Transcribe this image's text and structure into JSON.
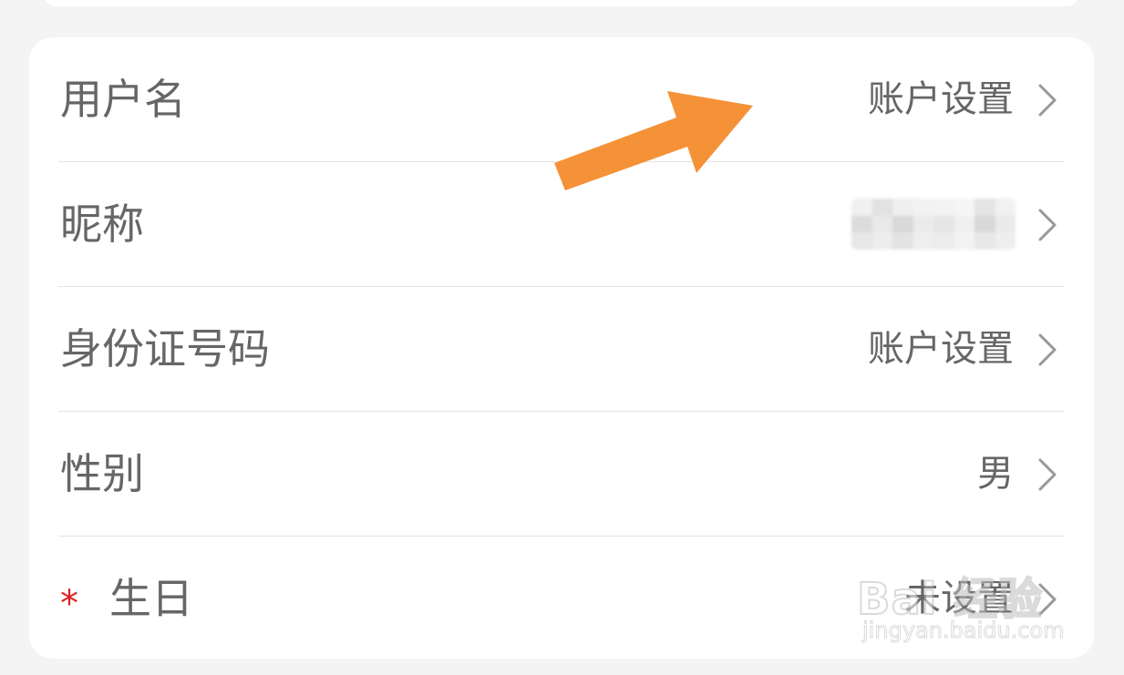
{
  "rows": [
    {
      "label": "用户名",
      "value": "账户设置"
    },
    {
      "label": "昵称",
      "value": ""
    },
    {
      "label": "身份证号码",
      "value": "账户设置"
    },
    {
      "label": "性别",
      "value": "男"
    },
    {
      "label": "生日",
      "value": "未设置",
      "required_mark": "*"
    }
  ],
  "annotation": {
    "arrow_color": "#f59137",
    "target": "账户设置"
  },
  "watermark": {
    "logo": "Bai 经验",
    "url": "jingyan.baidu.com"
  },
  "colors": {
    "label_text": "#666666",
    "required_star": "#e02020",
    "chevron": "#999999",
    "divider": "#e4e4e4",
    "background": "#f4f4f4",
    "card": "#ffffff"
  },
  "icons": {
    "chevron": "chevron-right-icon"
  }
}
